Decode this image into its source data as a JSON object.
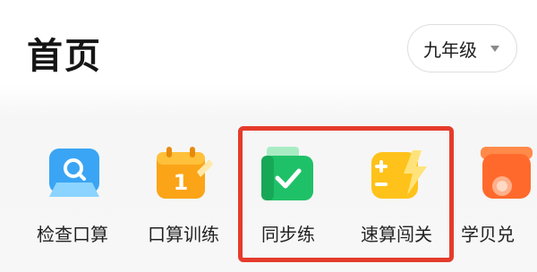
{
  "header": {
    "title": "首页",
    "grade_select": {
      "value": "九年级"
    }
  },
  "features": [
    {
      "label": "检查口算",
      "icon": "magnifier-tablet-icon"
    },
    {
      "label": "口算训练",
      "icon": "calendar-one-icon"
    },
    {
      "label": "同步练",
      "icon": "checkmark-book-icon"
    },
    {
      "label": "速算闯关",
      "icon": "plus-minus-lightning-icon"
    },
    {
      "label": "学贝兑",
      "icon": "gift-shop-icon"
    }
  ],
  "colors": {
    "highlight_border": "#e53b2c",
    "check_blue": "#3aa5f4",
    "train_orange": "#fba417",
    "sync_green": "#1fc168",
    "speed_yellow": "#ffc21a",
    "shop_orange": "#ff6a2c"
  }
}
